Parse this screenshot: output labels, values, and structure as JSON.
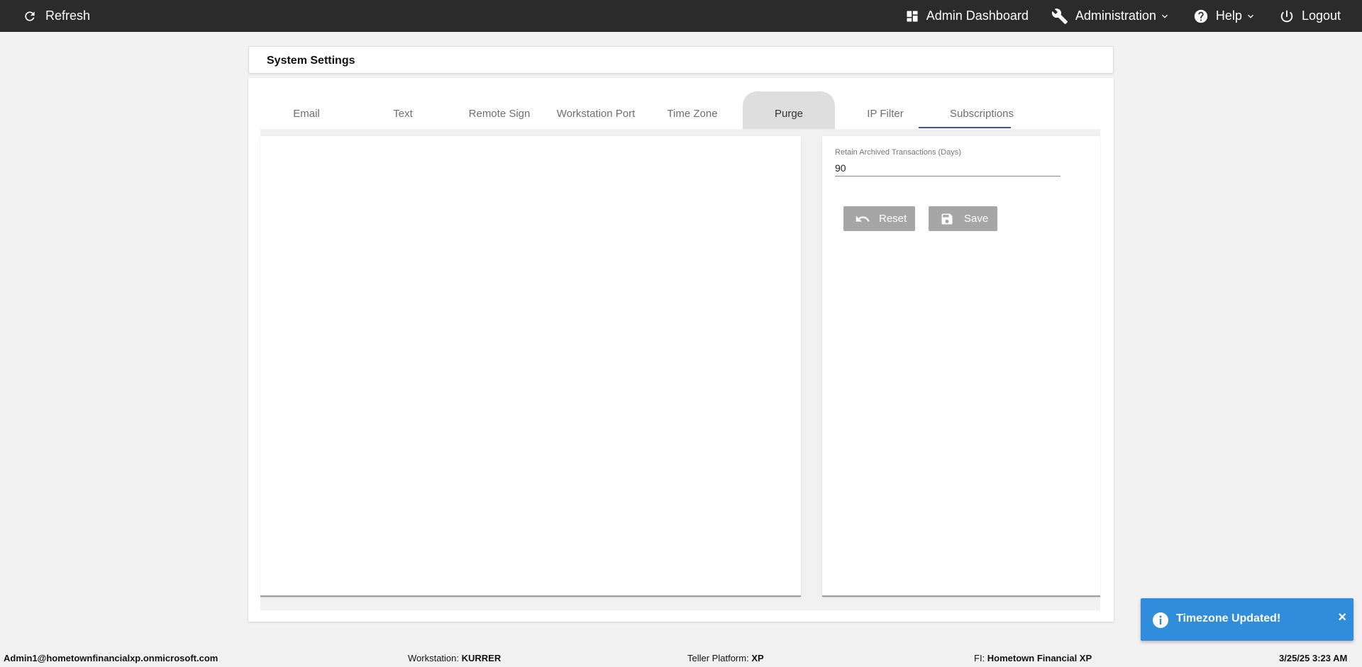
{
  "topbar": {
    "refresh_label": "Refresh",
    "admin_dashboard_label": "Admin Dashboard",
    "administration_label": "Administration",
    "help_label": "Help",
    "logout_label": "Logout"
  },
  "page": {
    "title": "System Settings"
  },
  "tabs": [
    {
      "label": "Email"
    },
    {
      "label": "Text"
    },
    {
      "label": "Remote Sign"
    },
    {
      "label": "Workstation Port"
    },
    {
      "label": "Time Zone"
    },
    {
      "label": "Purge"
    },
    {
      "label": "IP Filter"
    },
    {
      "label": "Subscriptions"
    }
  ],
  "active_tab": "Purge",
  "purge": {
    "retain_label": "Retain Archived Transactions (Days)",
    "retain_value": "90",
    "reset_label": "Reset",
    "save_label": "Save"
  },
  "toast": {
    "message": "Timezone Updated!",
    "close": "×"
  },
  "footer": {
    "user": "Admin1@hometownfinancialxp.onmicrosoft.com",
    "workstation_label": "Workstation: ",
    "workstation_value": "KURRER",
    "platform_label": "Teller Platform: ",
    "platform_value": "XP",
    "fi_label": "FI: ",
    "fi_value": "Hometown Financial XP",
    "datetime": "3/25/25 3:23 AM"
  },
  "colors": {
    "topbar": "#2b2b2b",
    "tab_underline": "#3f51b5",
    "toast": "#2f8ddb",
    "button": "#a6a6a6"
  },
  "icons": [
    "refresh-icon",
    "dashboard-icon",
    "wrench-icon",
    "help-icon",
    "power-icon",
    "chevron-down-icon",
    "undo-icon",
    "save-icon",
    "info-icon",
    "close-icon"
  ]
}
